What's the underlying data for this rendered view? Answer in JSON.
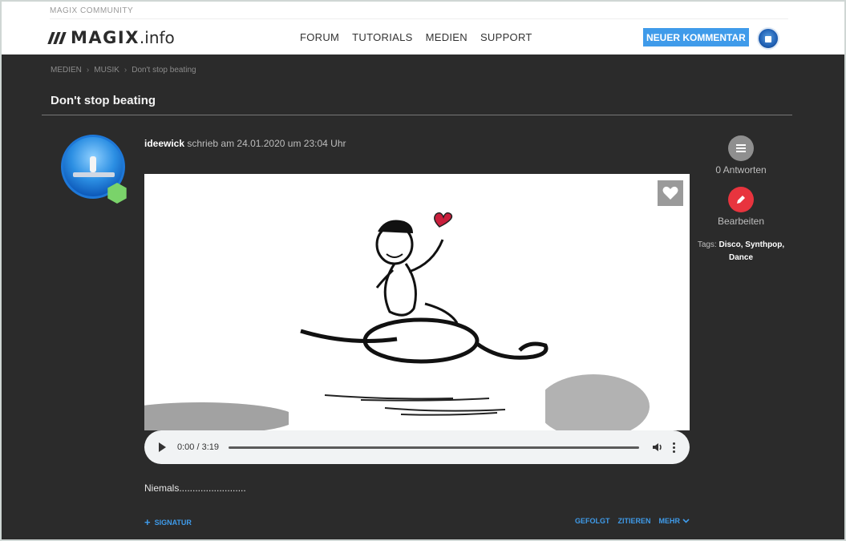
{
  "header": {
    "community": "MAGIX COMMUNITY",
    "logo_main": "MAGIX",
    "logo_suffix": ".info",
    "nav": [
      "FORUM",
      "TUTORIALS",
      "MEDIEN",
      "SUPPORT"
    ],
    "new_comment": "NEUER KOMMENTAR"
  },
  "breadcrumb": [
    "MEDIEN",
    "MUSIK",
    "Don't stop beating"
  ],
  "page_title": "Don't stop beating",
  "post": {
    "author": "ideewick",
    "meta_text": "schrieb am 24.01.2020 um 23:04 Uhr",
    "audio_time": "0:00 / 3:19",
    "body": "Niemals.........................",
    "signature": "SIGNATUR",
    "actions": [
      "GEFOLGT",
      "ZITIEREN",
      "MEHR"
    ]
  },
  "sidebar": {
    "replies": "0 Antworten",
    "edit": "Bearbeiten",
    "tags_label": "Tags:",
    "tags": "Disco, Synthpop, Dance"
  },
  "colors": {
    "accent": "#3f9bea",
    "background": "#2b2b2b",
    "edit_red": "#e8343e"
  }
}
